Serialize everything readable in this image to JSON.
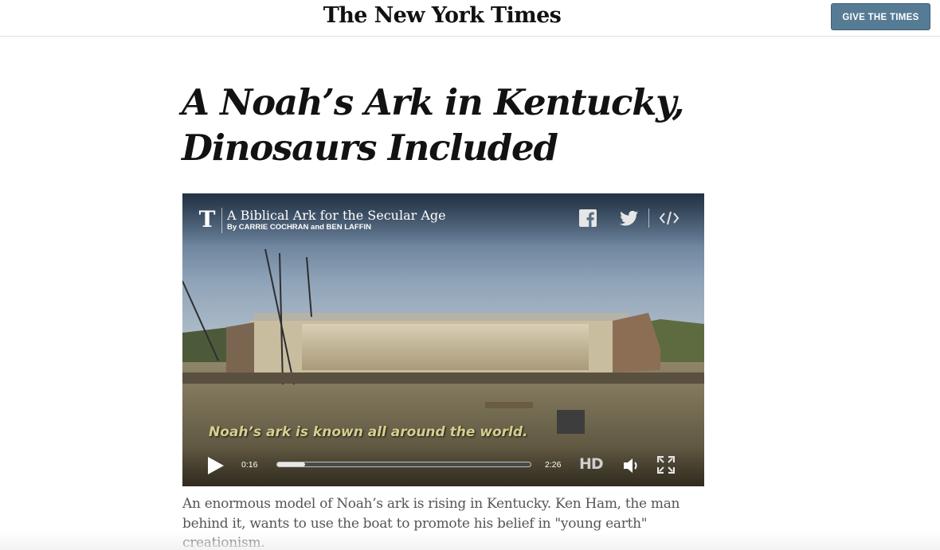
{
  "header": {
    "masthead": "The New York Times",
    "give_button": "GIVE THE TIMES"
  },
  "article": {
    "headline": "A Noah’s Ark in Kentucky, Dinosaurs Included",
    "caption": "An enormous model of Noah’s ark is rising in Kentucky. Ken Ham, the man behind it, wants to use the boat to promote his belief in \"young earth\" creationism."
  },
  "video": {
    "logo": "T",
    "title": "A Biblical Ark for the Secular Age",
    "byline": "By CARRIE COCHRAN and BEN LAFFIN",
    "subtitle": "Noah’s ark is known all around the world.",
    "current_time": "0:16",
    "duration": "2:26",
    "progress": 0.11,
    "hd_label": "HD",
    "share_icons": [
      "facebook-icon",
      "twitter-icon",
      "embed-icon"
    ],
    "control_icons": [
      "play-icon",
      "volume-icon",
      "fullscreen-icon"
    ]
  },
  "colors": {
    "give_button_bg": "#567b95",
    "subtitle_text": "#d7cf8f",
    "caption_text": "#555555"
  }
}
